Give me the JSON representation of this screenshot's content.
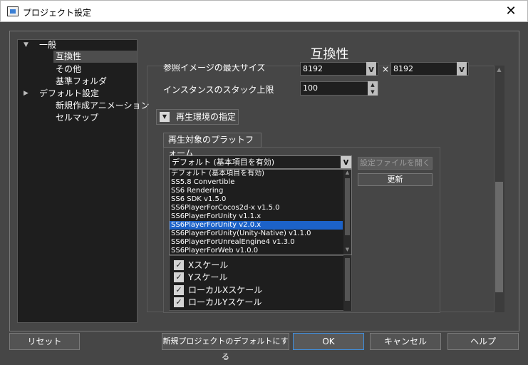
{
  "window": {
    "title": "プロジェクト設定",
    "close_glyph": "✕"
  },
  "tree": {
    "items": [
      {
        "label": "一般",
        "expanded": true
      },
      {
        "label": "互換性",
        "selected": true
      },
      {
        "label": "その他"
      },
      {
        "label": "基準フォルダ"
      },
      {
        "label": "デフォルト設定",
        "expanded": true
      },
      {
        "label": "新規作成アニメーション"
      },
      {
        "label": "セルマップ"
      }
    ]
  },
  "page": {
    "title": "互換性"
  },
  "settings": {
    "ref_image_label": "参照イメージの最大サイズ",
    "ref_image_w": "8192",
    "ref_image_sep": "×",
    "ref_image_h": "8192",
    "instance_label": "インスタンスのスタック上限",
    "instance_value": "100"
  },
  "playback": {
    "section_label": "再生環境の指定",
    "platform_group": "再生対象のプラットフォーム",
    "selected": "デフォルト (基本項目を有効)",
    "open_config_button": "設定ファイルを開く",
    "update_button": "更新",
    "options": [
      "デフォルト (基本項目を有効)",
      "SS5.8 Convertible",
      "SS6 Rendering",
      "SS6 SDK v1.5.0",
      "SS6PlayerForCocos2d-x v1.5.0",
      "SS6PlayerForUnity v1.1.x",
      "SS6PlayerForUnity v2.0.x",
      "SS6PlayerForUnity(Unity-Native) v1.1.0",
      "SS6PlayerForUnrealEngine4 v1.3.0",
      "SS6PlayerForWeb v1.0.0"
    ],
    "highlighted_option": "SS6PlayerForUnity v2.0.x",
    "checks": [
      {
        "label": "Xスケール",
        "checked": true
      },
      {
        "label": "Yスケール",
        "checked": true
      },
      {
        "label": "ローカルXスケール",
        "checked": true
      },
      {
        "label": "ローカルYスケール",
        "checked": true
      }
    ]
  },
  "footer": {
    "reset": "リセット",
    "default_new_project": "新規プロジェクトのデフォルトにする",
    "ok": "OK",
    "cancel": "キャンセル",
    "help": "ヘルプ"
  },
  "colors": {
    "highlight": "#1c62c8",
    "background": "#464646",
    "ok_border": "#3f8fe0"
  }
}
